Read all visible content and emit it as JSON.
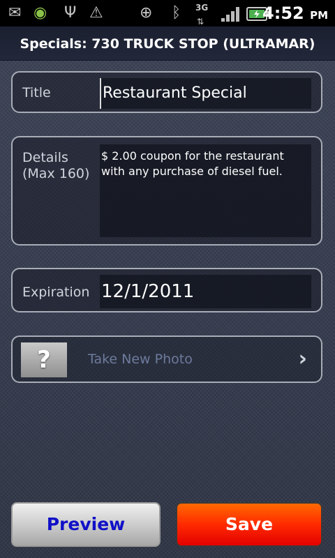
{
  "status_bar": {
    "time": "4:52",
    "ampm": "PM",
    "network": "3G",
    "icons": [
      "mail-icon",
      "android-icon",
      "usb-icon",
      "warning-icon",
      "gps-icon",
      "bluetooth-icon",
      "signal-icon",
      "battery-icon"
    ]
  },
  "header": {
    "title": "Specials: 730 TRUCK STOP (ULTRAMAR)"
  },
  "form": {
    "title_label": "Title",
    "title_value": "Restaurant Special",
    "details_label": "Details",
    "details_hint": "(Max 160)",
    "details_value": "$ 2.00 coupon for the restaurant with any purchase of diesel fuel.",
    "expiration_label": "Expiration",
    "expiration_value": "12/1/2011",
    "photo_label": "Take New Photo",
    "photo_placeholder": "?"
  },
  "buttons": {
    "preview": "Preview",
    "save": "Save"
  },
  "colors": {
    "save_button": "#ff2a00",
    "preview_text": "#1010c8",
    "background": "#363d4f"
  }
}
